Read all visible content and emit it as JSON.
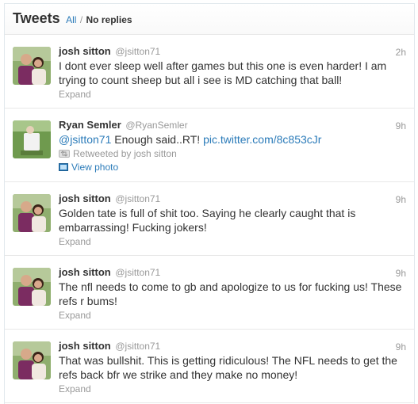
{
  "header": {
    "title": "Tweets",
    "filter_all": "All",
    "separator": "/",
    "filter_noreplies": "No replies"
  },
  "tweets": [
    {
      "name": "josh sitton",
      "handle": "@jsitton71",
      "time": "2h",
      "text": "I dont ever sleep well after games but this one is even harder! I am trying to count sheep but all i see is MD catching that ball!",
      "action": "Expand"
    },
    {
      "name": "Ryan Semler",
      "handle": "@RyanSemler",
      "time": "9h",
      "mention": "@jsitton71",
      "text": " Enough said..RT! ",
      "link": "pic.twitter.com/8c853cJr",
      "retweeted_by": "Retweeted by josh sitton",
      "action": "View photo"
    },
    {
      "name": "josh sitton",
      "handle": "@jsitton71",
      "time": "9h",
      "text": "Golden tate is full of shit too. Saying he clearly caught that is embarrassing! Fucking jokers!",
      "action": "Expand"
    },
    {
      "name": "josh sitton",
      "handle": "@jsitton71",
      "time": "9h",
      "text": "The nfl needs to come to gb and apologize to us for fucking us! These refs r bums!",
      "action": "Expand"
    },
    {
      "name": "josh sitton",
      "handle": "@jsitton71",
      "time": "9h",
      "text": "That was bullshit. This is getting ridiculous! The NFL needs to get the refs back bfr we strike and they make no money!",
      "action": "Expand"
    }
  ],
  "colors": {
    "link": "#2b7bb9",
    "muted": "#999999",
    "text": "#333333",
    "divider": "#e8e8e8"
  }
}
